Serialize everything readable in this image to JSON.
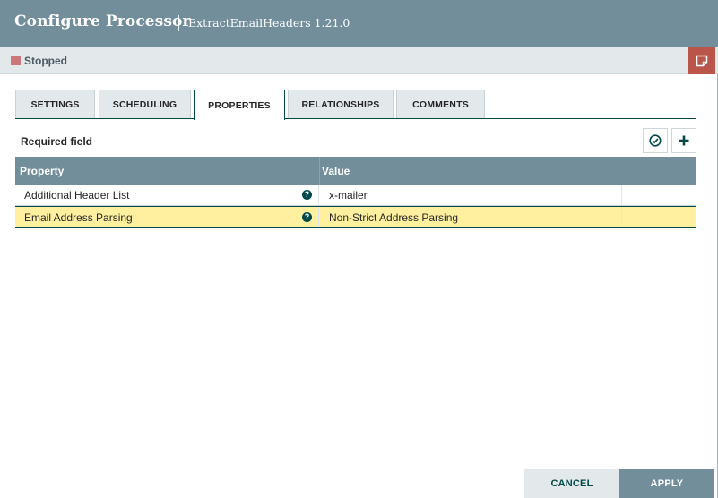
{
  "header": {
    "title": "Configure Processor",
    "subtitle": "ExtractEmailHeaders 1.21.0"
  },
  "status": {
    "text": "Stopped",
    "color": "#ca787b"
  },
  "tabs": [
    {
      "label": "SETTINGS",
      "active": false
    },
    {
      "label": "SCHEDULING",
      "active": false
    },
    {
      "label": "PROPERTIES",
      "active": true
    },
    {
      "label": "RELATIONSHIPS",
      "active": false
    },
    {
      "label": "COMMENTS",
      "active": false
    }
  ],
  "properties": {
    "required_label": "Required field",
    "columns": {
      "property": "Property",
      "value": "Value"
    },
    "rows": [
      {
        "name": "Additional Header List",
        "value": "x-mailer",
        "selected": false
      },
      {
        "name": "Email Address Parsing",
        "value": "Non-Strict Address Parsing",
        "selected": true
      }
    ],
    "help_glyph": "?"
  },
  "footer": {
    "cancel": "CANCEL",
    "apply": "APPLY"
  },
  "colors": {
    "header_bg": "#728e9b",
    "accent": "#004849",
    "selected_row": "#fff0a0",
    "comments_button": "#ba554a"
  }
}
